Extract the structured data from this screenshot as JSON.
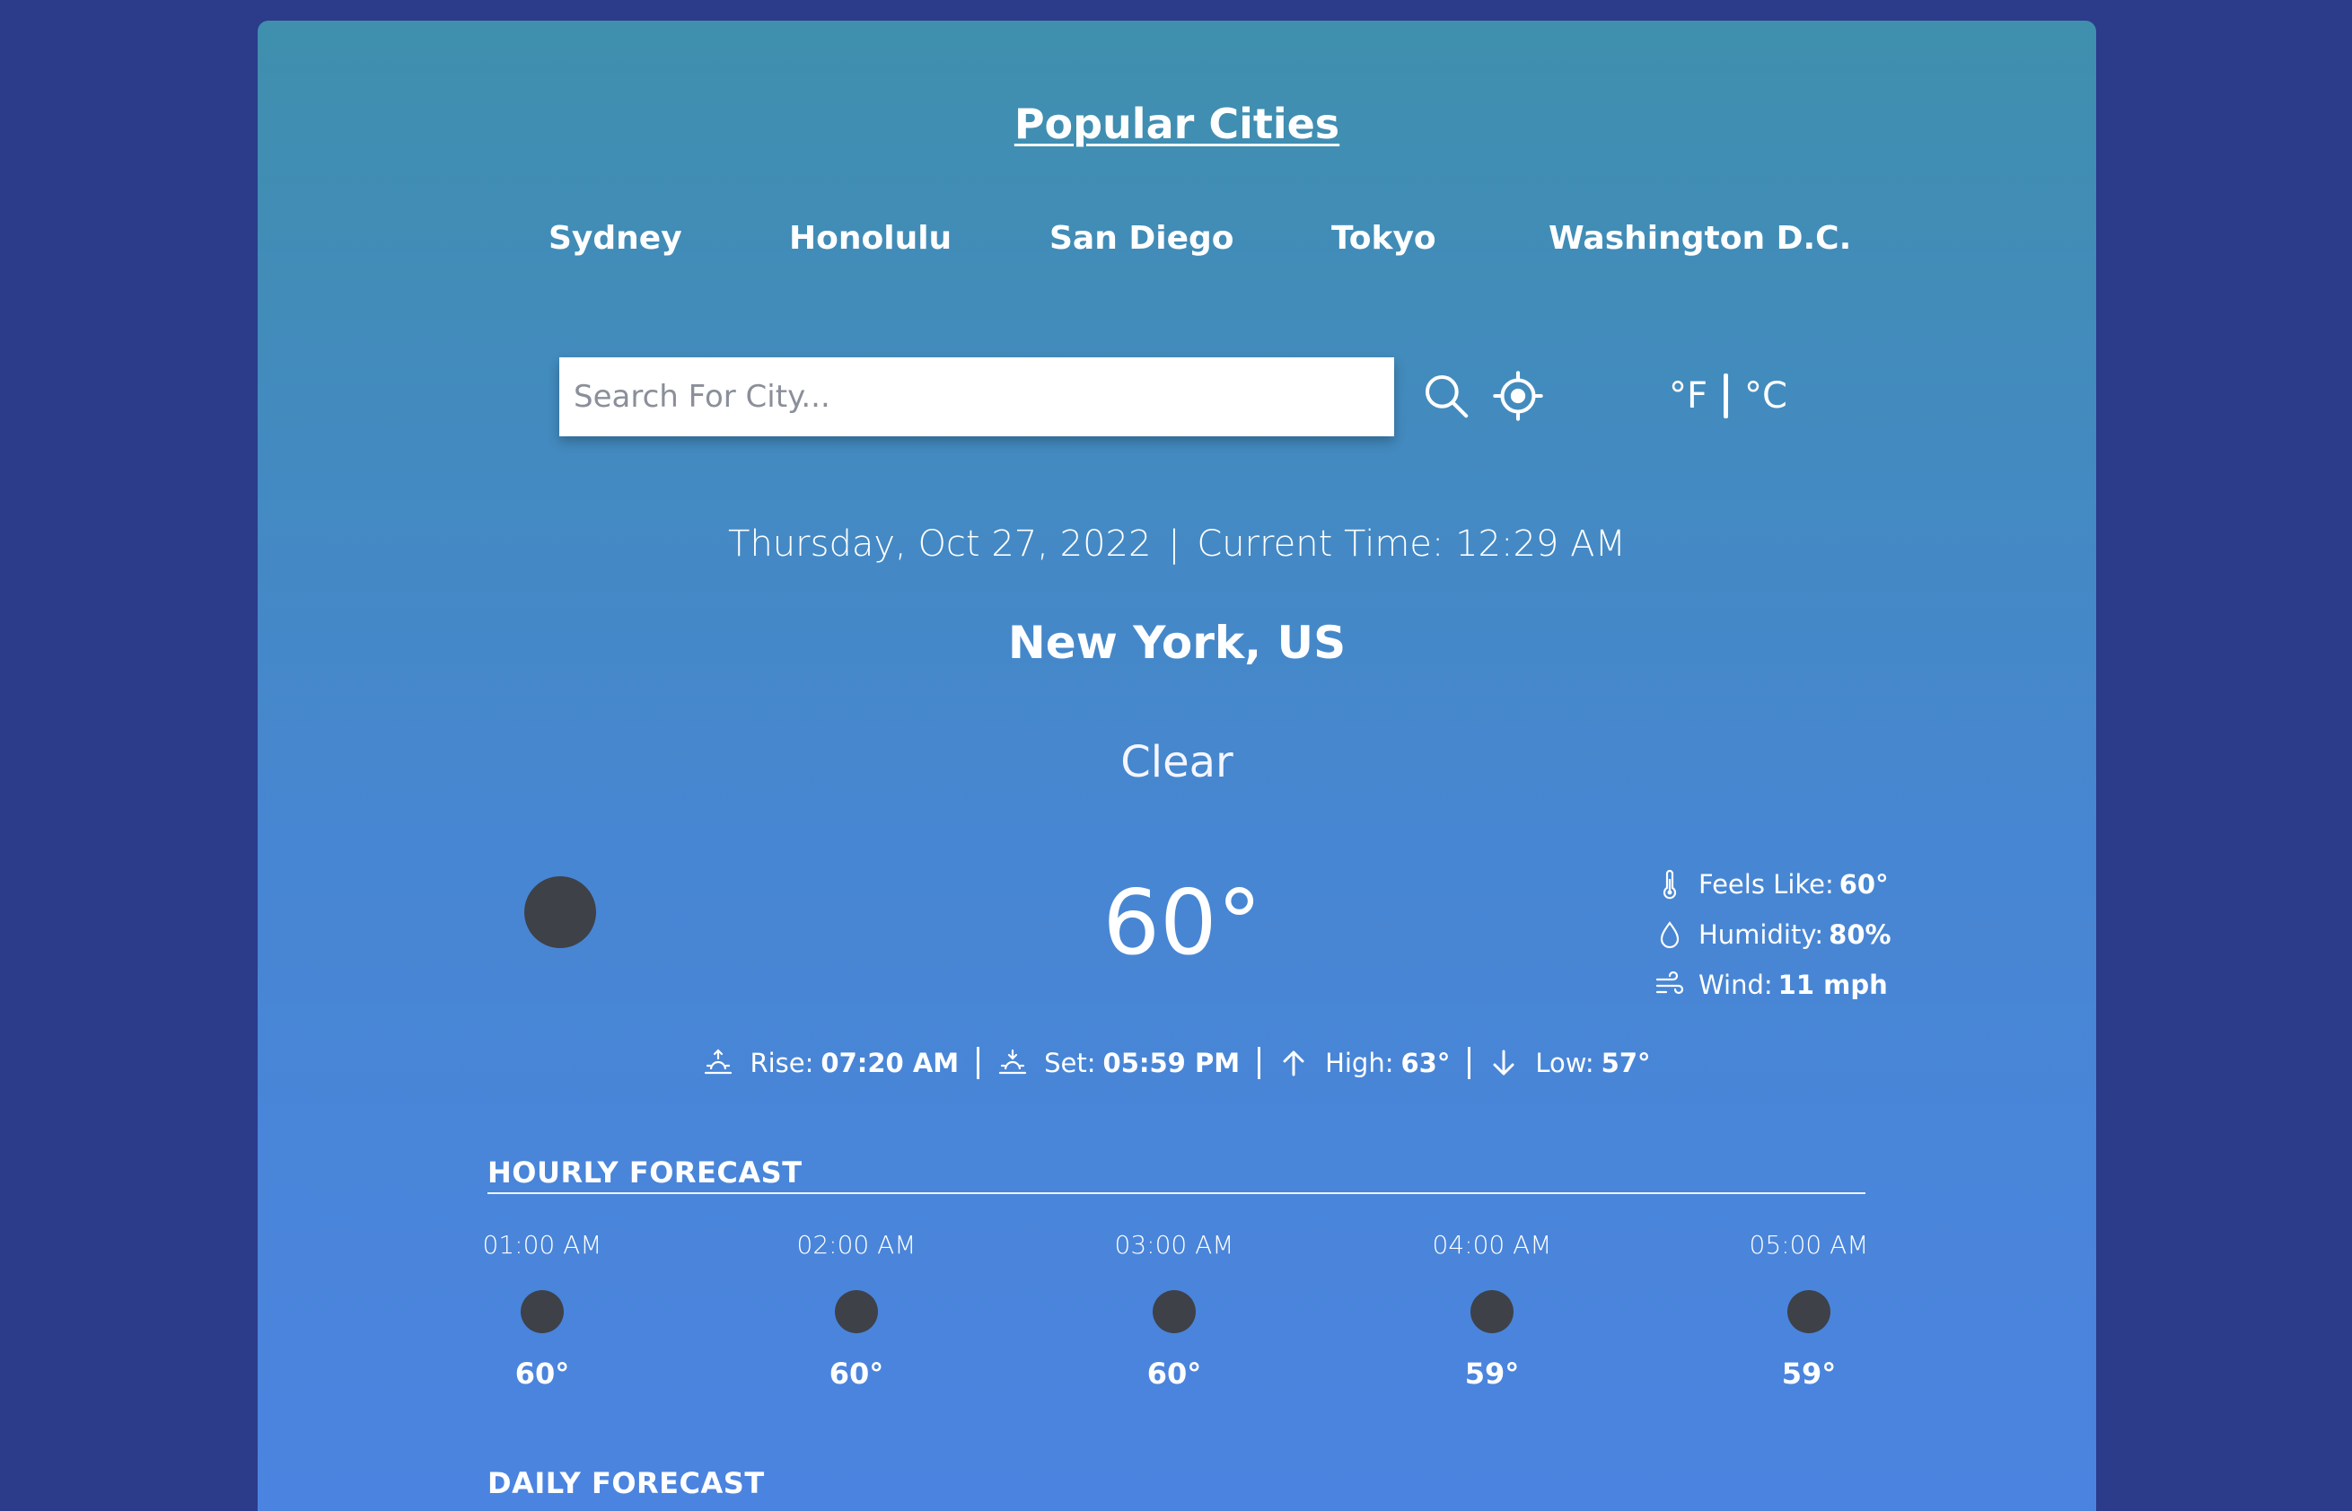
{
  "colors": {
    "page_background": "#2c3b8a",
    "card_gradient_top": "#3f8fad",
    "card_gradient_bottom": "#4b84e0",
    "text": "#ffffff",
    "weather_icon_placeholder": "#3e4148"
  },
  "popular": {
    "title": "Popular Cities",
    "cities": [
      "Sydney",
      "Honolulu",
      "San Diego",
      "Tokyo",
      "Washington D.C."
    ]
  },
  "search": {
    "placeholder": "Search For City...",
    "value": "",
    "search_icon": "search-icon",
    "location_icon": "location-crosshair-icon"
  },
  "units": {
    "fahrenheit": "°F",
    "celsius": "°C"
  },
  "current": {
    "date": "Thursday, Oct 27, 2022",
    "separator": "|",
    "time_label": "Current Time: 12:29 AM",
    "location": "New York, US",
    "condition": "Clear",
    "temperature": "60°",
    "feels_like_label": "Feels Like:",
    "feels_like": "60°",
    "humidity_label": "Humidity:",
    "humidity": "80%",
    "wind_label": "Wind:",
    "wind": "11 mph",
    "rise_label": "Rise:",
    "rise": "07:20 AM",
    "set_label": "Set:",
    "set": "05:59 PM",
    "high_label": "High:",
    "high": "63°",
    "low_label": "Low:",
    "low": "57°"
  },
  "hourly": {
    "title": "HOURLY FORECAST",
    "items": [
      {
        "time": "01:00 AM",
        "temp": "60°"
      },
      {
        "time": "02:00 AM",
        "temp": "60°"
      },
      {
        "time": "03:00 AM",
        "temp": "60°"
      },
      {
        "time": "04:00 AM",
        "temp": "59°"
      },
      {
        "time": "05:00 AM",
        "temp": "59°"
      }
    ]
  },
  "daily": {
    "title": "DAILY FORECAST"
  }
}
